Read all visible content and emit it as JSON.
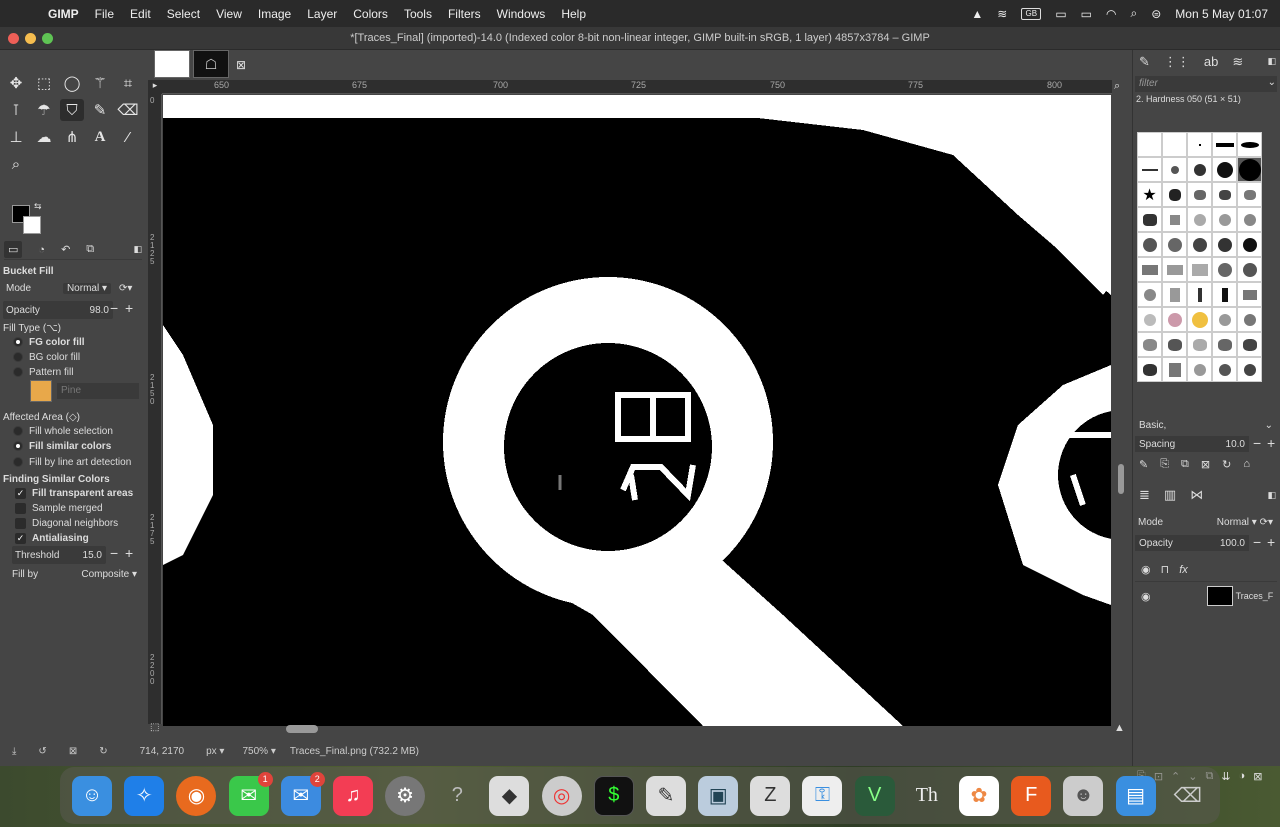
{
  "menubar": {
    "app": "GIMP",
    "items": [
      "File",
      "Edit",
      "Select",
      "View",
      "Image",
      "Layer",
      "Colors",
      "Tools",
      "Filters",
      "Windows",
      "Help"
    ],
    "input_source": "GB",
    "datetime": "Mon 5 May  01:07"
  },
  "window": {
    "title": "*[Traces_Final] (imported)-14.0 (Indexed color 8-bit non-linear integer, GIMP built-in sRGB, 1 layer) 4857x3784 – GIMP"
  },
  "toolbox": {
    "section_title": "Bucket Fill",
    "mode_label": "Mode",
    "mode_value": "Normal",
    "opacity_label": "Opacity",
    "opacity_value": "98.0",
    "fill_type_label": "Fill Type  (⌥)",
    "fill_options": [
      "FG color fill",
      "BG color fill",
      "Pattern fill"
    ],
    "pattern_name": "Pine",
    "affected_area_label": "Affected Area  (◇)",
    "area_options": [
      "Fill whole selection",
      "Fill similar colors",
      "Fill by line art detection"
    ],
    "finding_label": "Finding Similar Colors",
    "finding_options": [
      "Fill transparent areas",
      "Sample merged",
      "Diagonal neighbors",
      "Antialiasing"
    ],
    "threshold_label": "Threshold",
    "threshold_value": "15.0",
    "fillby_label": "Fill by",
    "fillby_value": "Composite"
  },
  "ruler": {
    "h_ticks": [
      "650",
      "675",
      "700",
      "725",
      "750",
      "775",
      "800"
    ],
    "v_ticks": [
      "2125",
      "2150",
      "2175",
      "2200"
    ],
    "origin": "0"
  },
  "status": {
    "coords": "714, 2170",
    "unit": "px",
    "zoom": "750%",
    "file": "Traces_Final.png (732.2 MB)"
  },
  "brushes": {
    "filter_placeholder": "filter",
    "selected": "2. Hardness 050 (51 × 51)",
    "preset": "Basic,",
    "spacing_label": "Spacing",
    "spacing_value": "10.0"
  },
  "layers": {
    "mode_label": "Mode",
    "mode_value": "Normal",
    "opacity_label": "Opacity",
    "opacity_value": "100.0",
    "layer_name": "Traces_F"
  },
  "dock": {
    "messages_badge": "1",
    "mail_badge": "2"
  }
}
